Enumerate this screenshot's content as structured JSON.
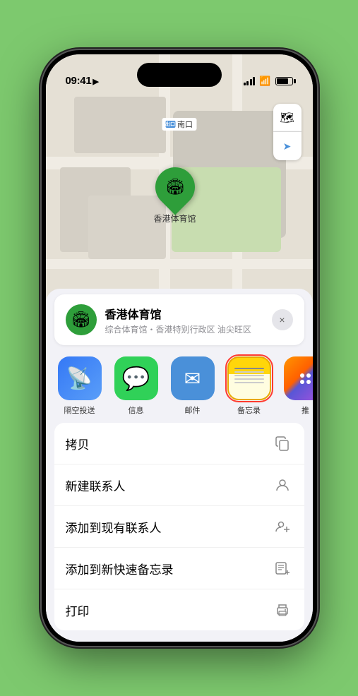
{
  "status_bar": {
    "time": "09:41",
    "location_arrow": "▶"
  },
  "map": {
    "label": "南口",
    "label_prefix": "出口"
  },
  "controls": {
    "map_icon": "🗺",
    "location_icon": "➤"
  },
  "stadium": {
    "name": "香港体育馆",
    "icon": "🏟",
    "subtitle": "综合体育馆・香港特别行政区 油尖旺区"
  },
  "share_items": [
    {
      "id": "airdrop",
      "label": "隔空投送",
      "icon": "📡"
    },
    {
      "id": "messages",
      "label": "信息",
      "icon": "💬"
    },
    {
      "id": "mail",
      "label": "邮件",
      "icon": "✉"
    },
    {
      "id": "notes",
      "label": "备忘录",
      "icon": "📝",
      "selected": true
    },
    {
      "id": "more",
      "label": "推",
      "icon": "⋯"
    }
  ],
  "action_items": [
    {
      "id": "copy",
      "label": "拷贝",
      "icon": "⎘"
    },
    {
      "id": "new-contact",
      "label": "新建联系人",
      "icon": "👤"
    },
    {
      "id": "add-existing",
      "label": "添加到现有联系人",
      "icon": "👤"
    },
    {
      "id": "add-notes",
      "label": "添加到新快速备忘录",
      "icon": "📋"
    },
    {
      "id": "print",
      "label": "打印",
      "icon": "🖨"
    }
  ],
  "close_button": "×"
}
